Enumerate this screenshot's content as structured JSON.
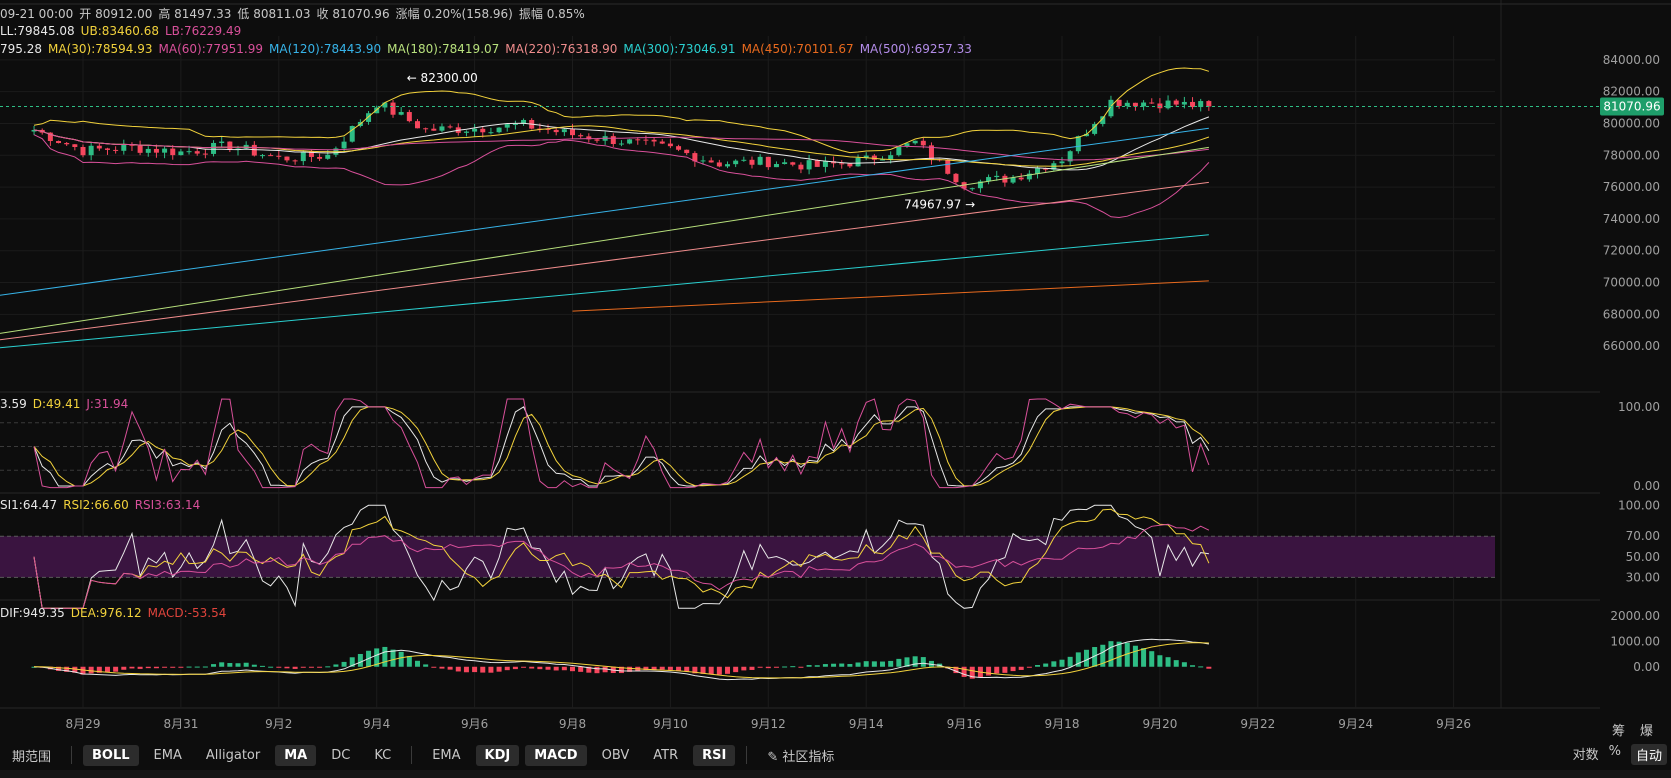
{
  "header": {
    "ohlc_line": [
      "09-21 00:00",
      "开 80912.00",
      "高 81497.33",
      "低 80811.03",
      "收 81070.96",
      "涨幅 0.20%(158.96)",
      "振幅 0.85%"
    ],
    "ma_line": [
      {
        "text": "795.28",
        "color": "#e8e8e8"
      },
      {
        "text": "MA(30):78594.93",
        "color": "#f2d23c"
      },
      {
        "text": "MA(60):77951.99",
        "color": "#d8509a"
      },
      {
        "text": "MA(120):78443.90",
        "color": "#37b3e8"
      },
      {
        "text": "MA(180):78419.07",
        "color": "#b7e07c"
      },
      {
        "text": "MA(220):76318.90",
        "color": "#ef8c8c"
      },
      {
        "text": "MA(300):73046.91",
        "color": "#2ad0d0"
      },
      {
        "text": "MA(450):70101.67",
        "color": "#e86a1e"
      },
      {
        "text": "MA(500):69257.33",
        "color": "#b38ce8"
      }
    ],
    "boll_line": [
      {
        "text": "LL:79845.08",
        "color": "#e8e8e8"
      },
      {
        "text": "UB:83460.68",
        "color": "#f2d23c"
      },
      {
        "text": "LB:76229.49",
        "color": "#d8509a"
      }
    ],
    "kdj_line": [
      {
        "text": "3.59",
        "color": "#e8e8e8"
      },
      {
        "text": "D:49.41",
        "color": "#f2d23c"
      },
      {
        "text": "J:31.94",
        "color": "#d8509a"
      }
    ],
    "rsi_line": [
      {
        "text": "SI1:64.47",
        "color": "#e8e8e8"
      },
      {
        "text": "RSI2:66.60",
        "color": "#f2d23c"
      },
      {
        "text": "RSI3:63.14",
        "color": "#d8509a"
      }
    ],
    "macd_line": [
      {
        "text": "DIF:949.35",
        "color": "#e8e8e8"
      },
      {
        "text": "DEA:976.12",
        "color": "#f2d23c"
      },
      {
        "text": "MACD:-53.54",
        "color": "#e0443c"
      }
    ]
  },
  "annotations": {
    "high_label": "← 82300.00",
    "low_label": "74967.97 →",
    "last_price": "81070.96"
  },
  "toolbar": {
    "period_label": "期范围",
    "main_indicators": [
      {
        "label": "BOLL",
        "active": true
      },
      {
        "label": "EMA",
        "active": false
      },
      {
        "label": "Alligator",
        "active": false
      },
      {
        "label": "MA",
        "active": true
      },
      {
        "label": "DC",
        "active": false
      },
      {
        "label": "KC",
        "active": false
      }
    ],
    "sub_indicators": [
      {
        "label": "EMA",
        "active": false
      },
      {
        "label": "KDJ",
        "active": true
      },
      {
        "label": "MACD",
        "active": true
      },
      {
        "label": "OBV",
        "active": false
      },
      {
        "label": "ATR",
        "active": false
      },
      {
        "label": "RSI",
        "active": true
      }
    ],
    "community_label": "社区指标",
    "right": {
      "log": "对数",
      "percent": "%",
      "auto": "自动"
    },
    "corner_labels": [
      "筹",
      "爆"
    ]
  },
  "chart_data": {
    "type": "candlestick",
    "x_ticks": [
      "8月29",
      "8月31",
      "9月2",
      "9月4",
      "9月6",
      "9月8",
      "9月10",
      "9月12",
      "9月14",
      "9月16",
      "9月18",
      "9月20",
      "9月22",
      "9月24",
      "9月26"
    ],
    "price_axis": {
      "ticks": [
        "84000.00",
        "82000.00",
        "80000.00",
        "78000.00",
        "76000.00",
        "74000.00",
        "72000.00",
        "70000.00",
        "68000.00",
        "66000.00"
      ],
      "ylim": [
        64500,
        85500
      ]
    },
    "price_path": [
      [
        "8月28",
        79600
      ],
      [
        "8月29",
        78300
      ],
      [
        "8月30",
        78500
      ],
      [
        "8月31",
        78200
      ],
      [
        "9月1",
        78600
      ],
      [
        "9月2",
        77800
      ],
      [
        "9月3",
        78000
      ],
      [
        "9月4",
        81300
      ],
      [
        "9月5",
        79600
      ],
      [
        "9月6",
        79700
      ],
      [
        "9月7",
        79900
      ],
      [
        "9月8",
        79300
      ],
      [
        "9月9",
        78900
      ],
      [
        "9月10",
        78400
      ],
      [
        "9月11",
        77500
      ],
      [
        "9月12",
        77600
      ],
      [
        "9月13",
        77300
      ],
      [
        "9月14",
        77700
      ],
      [
        "9月15",
        78800
      ],
      [
        "9月16",
        76200
      ],
      [
        "9月17",
        76600
      ],
      [
        "9月18",
        77800
      ],
      [
        "9月19",
        81400
      ],
      [
        "9月20",
        81300
      ],
      [
        "9月21",
        81071
      ]
    ],
    "kdj_axis": {
      "ticks": [
        "100.00",
        "0.00"
      ],
      "ylim": [
        -5,
        115
      ]
    },
    "rsi_axis": {
      "ticks": [
        "100.00",
        "70.00",
        "50.00",
        "30.00"
      ],
      "ylim": [
        10,
        110
      ]
    },
    "macd_axis": {
      "ticks": [
        "2000.00",
        "1000.00",
        "0.00"
      ],
      "ylim": [
        -1500,
        2500
      ]
    }
  }
}
